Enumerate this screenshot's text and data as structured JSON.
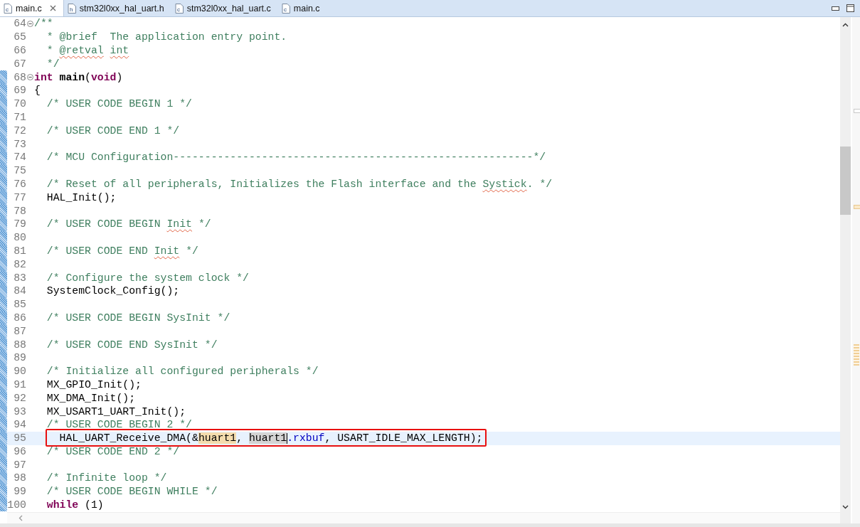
{
  "tabs": [
    {
      "label": "main.c",
      "type": "c",
      "selected": true,
      "closable": true
    },
    {
      "label": "stm32l0xx_hal_uart.h",
      "type": "h",
      "selected": false,
      "closable": false
    },
    {
      "label": "stm32l0xx_hal_uart.c",
      "type": "c",
      "selected": false,
      "closable": false
    },
    {
      "label": "main.c",
      "type": "c",
      "selected": false,
      "closable": false
    }
  ],
  "lines": [
    {
      "number": "64",
      "fold": true,
      "changed": false,
      "current": false,
      "annotated": false,
      "segments": [
        {
          "kind": "comment",
          "text": "/**"
        }
      ]
    },
    {
      "number": "65",
      "fold": false,
      "changed": false,
      "current": false,
      "annotated": false,
      "segments": [
        {
          "kind": "comment",
          "text": "  * @brief  The application entry point."
        }
      ]
    },
    {
      "number": "66",
      "fold": false,
      "changed": false,
      "current": false,
      "annotated": false,
      "segments": [
        {
          "kind": "comment",
          "text": "  * "
        },
        {
          "kind": "spell",
          "text": "@retval"
        },
        {
          "kind": "spell",
          "text": " int"
        }
      ]
    },
    {
      "number": "67",
      "fold": false,
      "changed": false,
      "current": false,
      "annotated": false,
      "segments": [
        {
          "kind": "comment",
          "text": "  */"
        }
      ]
    },
    {
      "number": "68",
      "fold": true,
      "changed": true,
      "current": false,
      "annotated": false,
      "segments": [
        {
          "kind": "keyword",
          "text": "int"
        },
        {
          "kind": "bold",
          "text": " main"
        },
        {
          "kind": "plain",
          "text": "("
        },
        {
          "kind": "keyword",
          "text": "void"
        },
        {
          "kind": "plain",
          "text": ")"
        }
      ]
    },
    {
      "number": "69",
      "fold": false,
      "changed": true,
      "current": false,
      "annotated": false,
      "segments": [
        {
          "kind": "plain",
          "text": "{"
        }
      ]
    },
    {
      "number": "70",
      "fold": false,
      "changed": true,
      "current": false,
      "annotated": false,
      "segments": [
        {
          "kind": "comment",
          "text": "  /* USER CODE BEGIN 1 */"
        }
      ]
    },
    {
      "number": "71",
      "fold": false,
      "changed": true,
      "current": false,
      "annotated": false
    },
    {
      "number": "72",
      "fold": false,
      "changed": true,
      "current": false,
      "annotated": false,
      "segments": [
        {
          "kind": "comment",
          "text": "  /* USER CODE END 1 */"
        }
      ]
    },
    {
      "number": "73",
      "fold": false,
      "changed": true,
      "current": false,
      "annotated": false
    },
    {
      "number": "74",
      "fold": false,
      "changed": true,
      "current": false,
      "annotated": false,
      "segments": [
        {
          "kind": "comment",
          "text": "  /* MCU Configuration---------------------------------------------------------*/"
        }
      ]
    },
    {
      "number": "75",
      "fold": false,
      "changed": true,
      "current": false,
      "annotated": false
    },
    {
      "number": "76",
      "fold": false,
      "changed": true,
      "current": false,
      "annotated": false,
      "segments": [
        {
          "kind": "comment",
          "text": "  /* Reset of all peripherals, Initializes the Flash interface and the "
        },
        {
          "kind": "spell",
          "text": "Systick"
        },
        {
          "kind": "comment",
          "text": ". */"
        }
      ]
    },
    {
      "number": "77",
      "fold": false,
      "changed": true,
      "current": false,
      "annotated": false,
      "segments": [
        {
          "kind": "plain",
          "text": "  HAL_Init();"
        }
      ]
    },
    {
      "number": "78",
      "fold": false,
      "changed": true,
      "current": false,
      "annotated": false
    },
    {
      "number": "79",
      "fold": false,
      "changed": true,
      "current": false,
      "annotated": false,
      "segments": [
        {
          "kind": "comment",
          "text": "  /* USER CODE BEGIN "
        },
        {
          "kind": "spell",
          "text": "Init"
        },
        {
          "kind": "comment",
          "text": " */"
        }
      ]
    },
    {
      "number": "80",
      "fold": false,
      "changed": true,
      "current": false,
      "annotated": false
    },
    {
      "number": "81",
      "fold": false,
      "changed": true,
      "current": false,
      "annotated": false,
      "segments": [
        {
          "kind": "comment",
          "text": "  /* USER CODE END "
        },
        {
          "kind": "spell",
          "text": "Init"
        },
        {
          "kind": "comment",
          "text": " */"
        }
      ]
    },
    {
      "number": "82",
      "fold": false,
      "changed": true,
      "current": false,
      "annotated": false
    },
    {
      "number": "83",
      "fold": false,
      "changed": true,
      "current": false,
      "annotated": false,
      "segments": [
        {
          "kind": "comment",
          "text": "  /* Configure the system clock */"
        }
      ]
    },
    {
      "number": "84",
      "fold": false,
      "changed": true,
      "current": false,
      "annotated": false,
      "segments": [
        {
          "kind": "plain",
          "text": "  SystemClock_Config();"
        }
      ]
    },
    {
      "number": "85",
      "fold": false,
      "changed": true,
      "current": false,
      "annotated": false
    },
    {
      "number": "86",
      "fold": false,
      "changed": true,
      "current": false,
      "annotated": false,
      "segments": [
        {
          "kind": "comment",
          "text": "  /* USER CODE BEGIN SysInit */"
        }
      ]
    },
    {
      "number": "87",
      "fold": false,
      "changed": true,
      "current": false,
      "annotated": false
    },
    {
      "number": "88",
      "fold": false,
      "changed": true,
      "current": false,
      "annotated": false,
      "segments": [
        {
          "kind": "comment",
          "text": "  /* USER CODE END SysInit */"
        }
      ]
    },
    {
      "number": "89",
      "fold": false,
      "changed": true,
      "current": false,
      "annotated": false
    },
    {
      "number": "90",
      "fold": false,
      "changed": true,
      "current": false,
      "annotated": false,
      "segments": [
        {
          "kind": "comment",
          "text": "  /* Initialize all configured peripherals */"
        }
      ]
    },
    {
      "number": "91",
      "fold": false,
      "changed": true,
      "current": false,
      "annotated": false,
      "segments": [
        {
          "kind": "plain",
          "text": "  MX_GPIO_Init();"
        }
      ]
    },
    {
      "number": "92",
      "fold": false,
      "changed": true,
      "current": false,
      "annotated": false,
      "segments": [
        {
          "kind": "plain",
          "text": "  MX_DMA_Init();"
        }
      ]
    },
    {
      "number": "93",
      "fold": false,
      "changed": true,
      "current": false,
      "annotated": false,
      "segments": [
        {
          "kind": "plain",
          "text": "  MX_USART1_UART_Init();"
        }
      ]
    },
    {
      "number": "94",
      "fold": false,
      "changed": true,
      "current": false,
      "annotated": false,
      "segments": [
        {
          "kind": "comment",
          "text": "  /* USER CODE BEGIN 2 */"
        }
      ]
    },
    {
      "number": "95",
      "fold": false,
      "changed": true,
      "current": true,
      "annotated": true,
      "segments": [
        {
          "kind": "plain",
          "text": "    HAL_UART_Receive_DMA(&"
        },
        {
          "kind": "occurrence",
          "text": "huart1"
        },
        {
          "kind": "plain",
          "text": ", "
        },
        {
          "kind": "selection",
          "text": "huart1",
          "caret": true
        },
        {
          "kind": "field",
          "text": ".rxbuf"
        },
        {
          "kind": "plain",
          "text": ", USART_IDLE_MAX_LENGTH);"
        }
      ]
    },
    {
      "number": "96",
      "fold": false,
      "changed": true,
      "current": false,
      "annotated": false,
      "segments": [
        {
          "kind": "comment",
          "text": "  /* USER CODE END 2 */"
        }
      ]
    },
    {
      "number": "97",
      "fold": false,
      "changed": true,
      "current": false,
      "annotated": false
    },
    {
      "number": "98",
      "fold": false,
      "changed": true,
      "current": false,
      "annotated": false,
      "segments": [
        {
          "kind": "comment",
          "text": "  /* Infinite loop */"
        }
      ]
    },
    {
      "number": "99",
      "fold": false,
      "changed": true,
      "current": false,
      "annotated": false,
      "segments": [
        {
          "kind": "comment",
          "text": "  /* USER CODE BEGIN WHILE */"
        }
      ]
    },
    {
      "number": "100",
      "fold": false,
      "changed": true,
      "current": false,
      "annotated": false,
      "segments": [
        {
          "kind": "keyword",
          "text": "  while"
        },
        {
          "kind": "plain",
          "text": " (1)"
        }
      ]
    }
  ]
}
